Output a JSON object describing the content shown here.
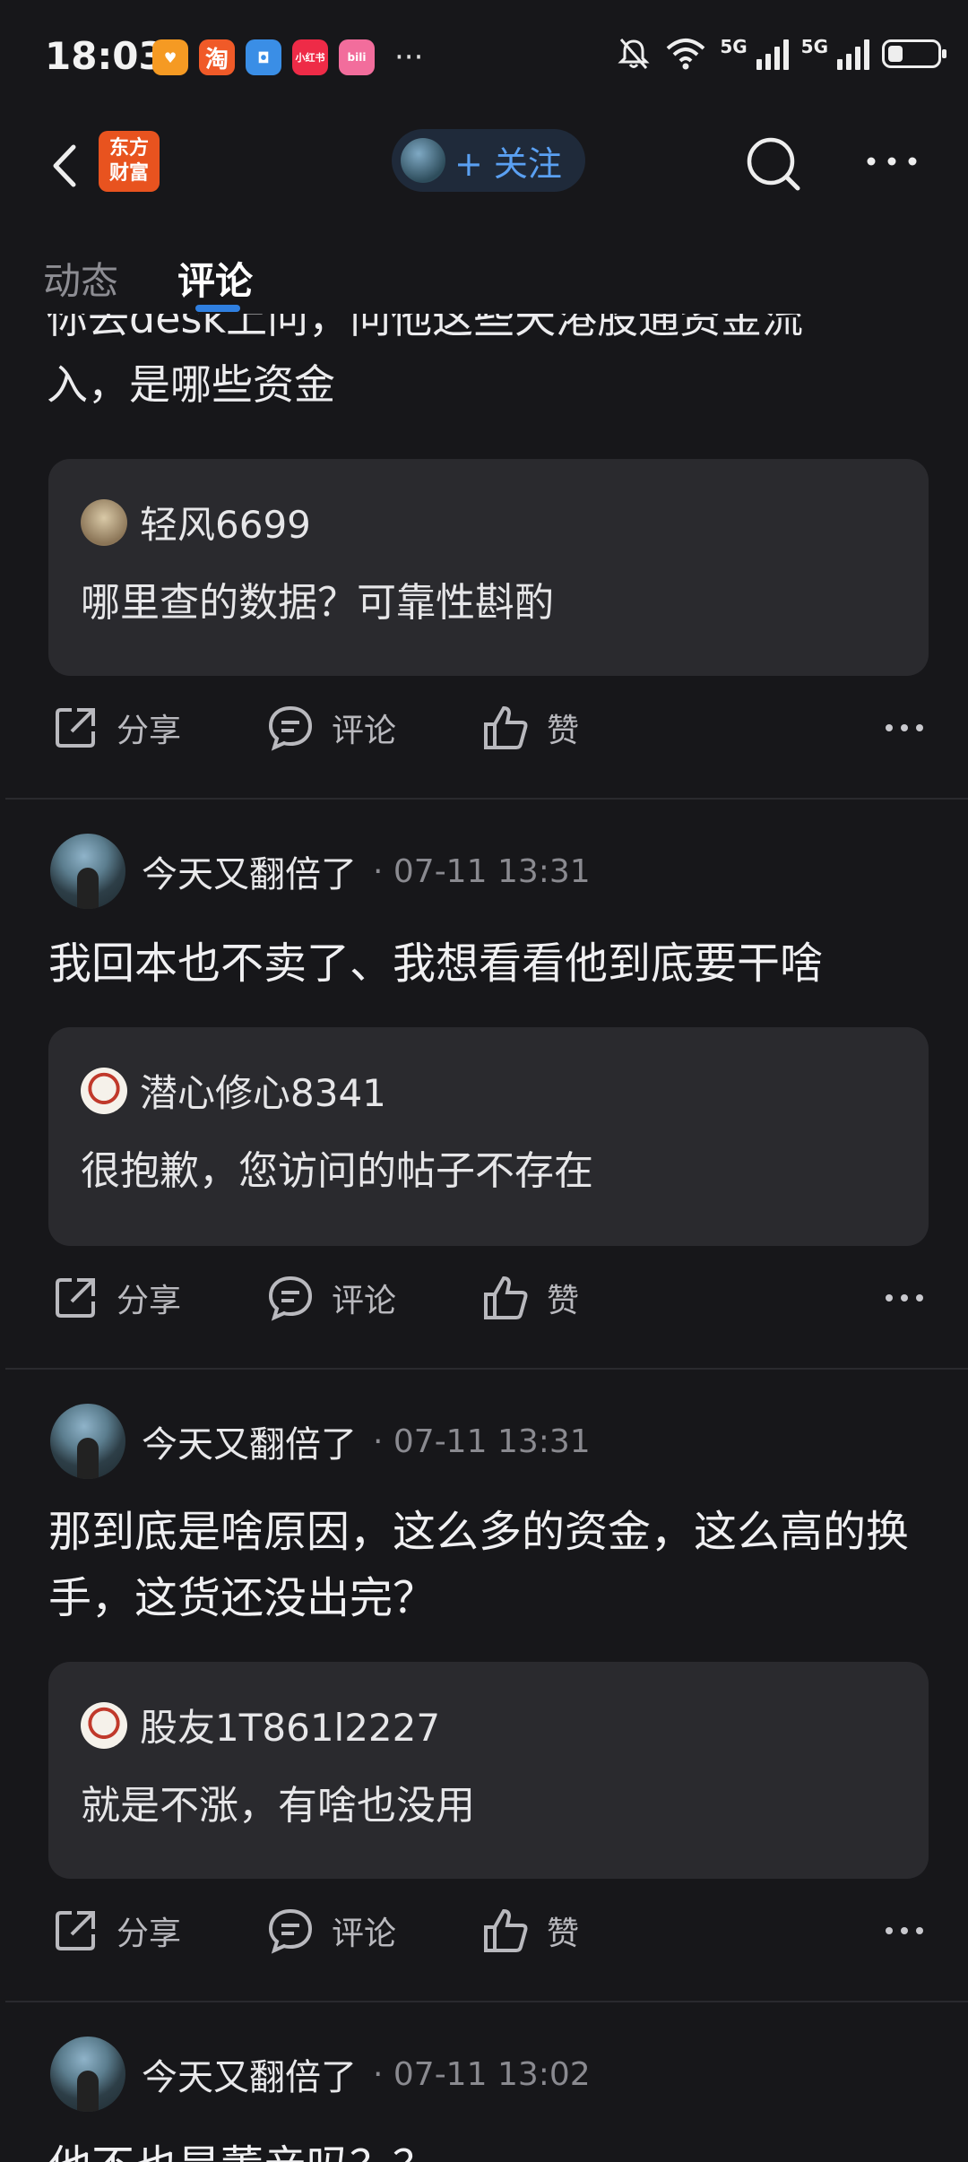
{
  "status_bar": {
    "time": "18:03",
    "app_icons": [
      {
        "name": "heart-app-icon",
        "color": "#f59a23",
        "glyph": "♥"
      },
      {
        "name": "taobao-app-icon",
        "color": "#f05a28",
        "glyph": "淘"
      },
      {
        "name": "notes-app-icon",
        "color": "#3a8ee6",
        "glyph": "◘"
      },
      {
        "name": "xiaohongshu-app-icon",
        "color": "#ee2b47",
        "glyph": "小红书"
      },
      {
        "name": "bilibili-app-icon",
        "color": "#f26d9c",
        "glyph": "bili"
      }
    ],
    "network_1": "5G",
    "network_2": "5G",
    "battery_level": 0.3
  },
  "header": {
    "logo_text": "东方\n财富",
    "follow_label": "+ 关注"
  },
  "tabs": [
    {
      "label": "动态",
      "active": false
    },
    {
      "label": "评论",
      "active": true
    }
  ],
  "feed": {
    "partial_post": {
      "text_cut": "你去desk上问，问他这些天港股通资金流",
      "text_line2": "入，是哪些资金",
      "quote": {
        "name": "轻风6699",
        "text": "哪里查的数据？可靠性斟酌"
      }
    },
    "posts": [
      {
        "author": "今天又翻倍了",
        "time": "· 07-11 13:31",
        "body": "我回本也不卖了、我想看看他到底要干啥",
        "quote": {
          "name": "潜心修心8341",
          "text": "很抱歉，您访问的帖子不存在"
        }
      },
      {
        "author": "今天又翻倍了",
        "time": "· 07-11 13:31",
        "body": "那到底是啥原因，这么多的资金，这么高的换手，这货还没出完？",
        "quote": {
          "name": "股友1T861l2227",
          "text": "就是不涨，有啥也没用"
        }
      },
      {
        "author": "今天又翻倍了",
        "time": "· 07-11 13:02",
        "body": "他不也是董亲吗？？"
      }
    ]
  },
  "actions": {
    "share": "分享",
    "comment": "评论",
    "like": "赞"
  }
}
